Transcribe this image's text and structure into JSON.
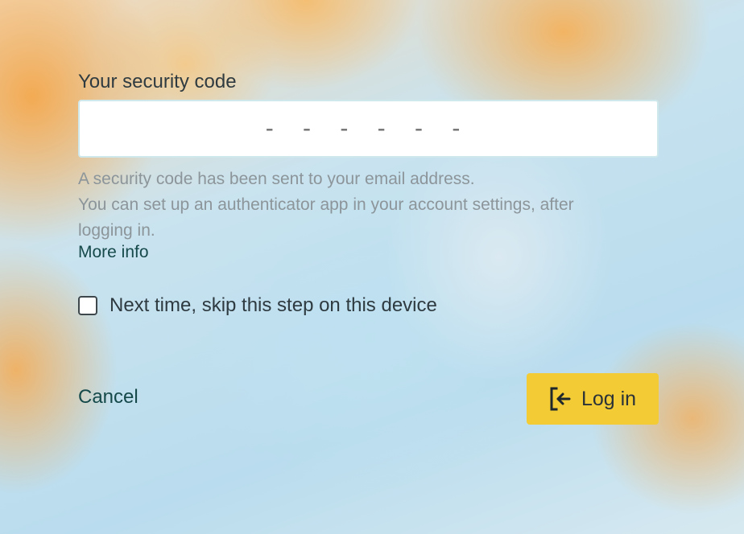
{
  "form": {
    "code_label": "Your security code",
    "code_placeholder": "- - - - - -",
    "help_lines": [
      "A security code has been sent to your email address.",
      "You can set up an authenticator app in your account settings, after logging in."
    ],
    "more_info_label": "More info",
    "skip_checkbox": {
      "checked": false,
      "label": "Next time, skip this step on this device"
    },
    "cancel_label": "Cancel",
    "login_label": "Log in",
    "login_icon": "log-in-icon"
  },
  "colors": {
    "primary_button": "#f2cb35",
    "link": "#15494a",
    "help_text": "#8c959a"
  }
}
